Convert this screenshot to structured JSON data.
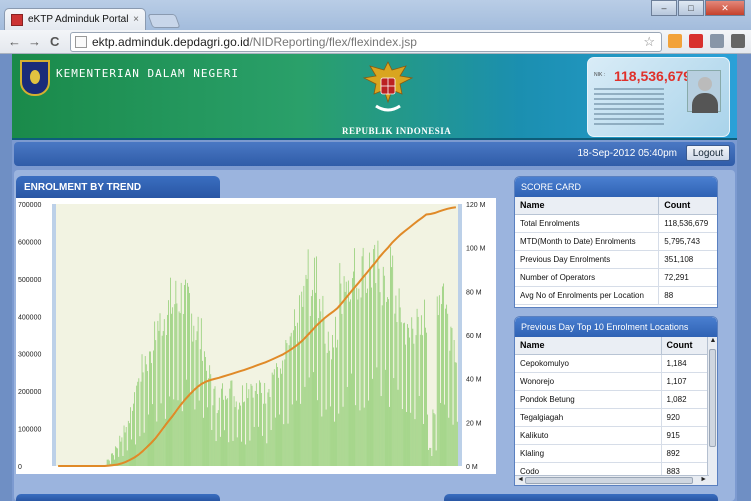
{
  "browser": {
    "tab_title": "eKTP Adminduk Portal",
    "tab_close": "×",
    "url_host": "ektp.adminduk.depdagri.go.id",
    "url_path": "/NIDReporting/flex/flexindex.jsp",
    "back": "←",
    "forward": "→",
    "reload": "C",
    "star": "☆",
    "win_min": "–",
    "win_max": "□",
    "win_close": "✕"
  },
  "header": {
    "ministry": "KEMENTERIAN DALAM NEGERI",
    "republik": "REPUBLIK INDONESIA",
    "card_total": "118,536,679",
    "datetime": "18-Sep-2012 05:40pm",
    "logout_label": "Logout"
  },
  "trend": {
    "title": "ENROLMENT BY TREND"
  },
  "chart_data": {
    "type": "bar",
    "title": "ENROLMENT BY TREND",
    "left_axis": {
      "ticks": [
        "0",
        "100000",
        "200000",
        "300000",
        "400000",
        "500000",
        "600000",
        "700000"
      ],
      "ylim": [
        0,
        700000
      ]
    },
    "right_axis": {
      "ticks": [
        "0 M",
        "20 M",
        "40 M",
        "60 M",
        "80 M",
        "100 M",
        "120 M"
      ],
      "ylim": [
        0,
        120000000
      ]
    },
    "series": [
      {
        "type": "bar",
        "color": "#6cc04a",
        "envelope_daily": [
          0,
          0,
          0,
          0,
          0,
          0,
          0,
          0,
          0,
          0,
          0,
          0,
          20000,
          40000,
          60000,
          90000,
          120000,
          160000,
          200000,
          260000,
          300000,
          340000,
          380000,
          400000,
          440000,
          470000,
          490000,
          510000,
          520000,
          530000,
          520000,
          500000,
          470000,
          440000,
          400000,
          350000,
          280000,
          220000,
          200000,
          230000,
          250000,
          240000,
          220000,
          210000,
          230000,
          250000,
          260000,
          240000,
          250000,
          230000,
          260000,
          300000,
          320000,
          290000,
          340000,
          380000,
          420000,
          460000,
          520000,
          600000,
          560000,
          620000,
          520000,
          460000,
          400000,
          360000,
          420000,
          560000,
          600000,
          620000,
          600000,
          580000,
          610000,
          590000,
          620000,
          600000,
          640000,
          580000,
          560000,
          600000,
          520000,
          480000,
          440000,
          400000,
          450000,
          430000,
          420000,
          460000,
          60000,
          160000,
          540000,
          560000,
          480000,
          440000,
          380000
        ]
      },
      {
        "type": "line",
        "color": "#e08a28",
        "axis": "right",
        "cumulative_millions": [
          0,
          0,
          0,
          0,
          0,
          0,
          0,
          0,
          0,
          0,
          0,
          0,
          0.2,
          0.4,
          0.7,
          1.2,
          1.9,
          2.8,
          3.9,
          5.2,
          6.8,
          8.6,
          10.6,
          12.8,
          15.2,
          17.7,
          20.3,
          22.9,
          25.5,
          28.0,
          30.4,
          32.6,
          34.6,
          36.3,
          37.7,
          38.7,
          39.4,
          39.9,
          40.4,
          41.0,
          41.6,
          42.2,
          42.8,
          43.4,
          44.0,
          44.7,
          45.4,
          46.1,
          46.8,
          47.5,
          48.3,
          49.2,
          50.1,
          51.0,
          52.1,
          53.3,
          54.7,
          56.2,
          58.0,
          60.0,
          62.0,
          64.2,
          66.1,
          67.8,
          69.3,
          70.7,
          72.3,
          74.5,
          76.9,
          79.3,
          81.6,
          83.9,
          86.3,
          88.6,
          91.0,
          93.3,
          95.8,
          98.0,
          100.1,
          102.4,
          104.3,
          106.1,
          107.7,
          109.2,
          110.8,
          112.3,
          113.7,
          115.2,
          115.4,
          115.9,
          116.6,
          117.2,
          117.8,
          118.2,
          118.5
        ]
      }
    ]
  },
  "scorecard": {
    "title": "SCORE CARD",
    "columns": [
      "Name",
      "Count"
    ],
    "rows": [
      [
        "Total Enrolments",
        "118,536,679"
      ],
      [
        "MTD(Month to Date) Enrolments",
        "5,795,743"
      ],
      [
        "Previous Day Enrolments",
        "351,108"
      ],
      [
        "Number of Operators",
        "72,291"
      ],
      [
        "Avg No of Enrolments per Location",
        "88"
      ]
    ]
  },
  "top10": {
    "title": "Previous Day Top 10 Enrolment Locations",
    "columns": [
      "Name",
      "Count"
    ],
    "rows": [
      [
        "Cepokomulyo",
        "1,184"
      ],
      [
        "Wonorejo",
        "1,107"
      ],
      [
        "Pondok Betung",
        "1,082"
      ],
      [
        "Tegalgiagah",
        "920"
      ],
      [
        "Kalikuto",
        "915"
      ],
      [
        "Klaling",
        "892"
      ],
      [
        "Codo",
        "883"
      ]
    ]
  },
  "colors": {
    "accent": "#2f62b4",
    "bar": "#6cc04a",
    "line": "#e08a28",
    "card_number": "#e0302a"
  }
}
